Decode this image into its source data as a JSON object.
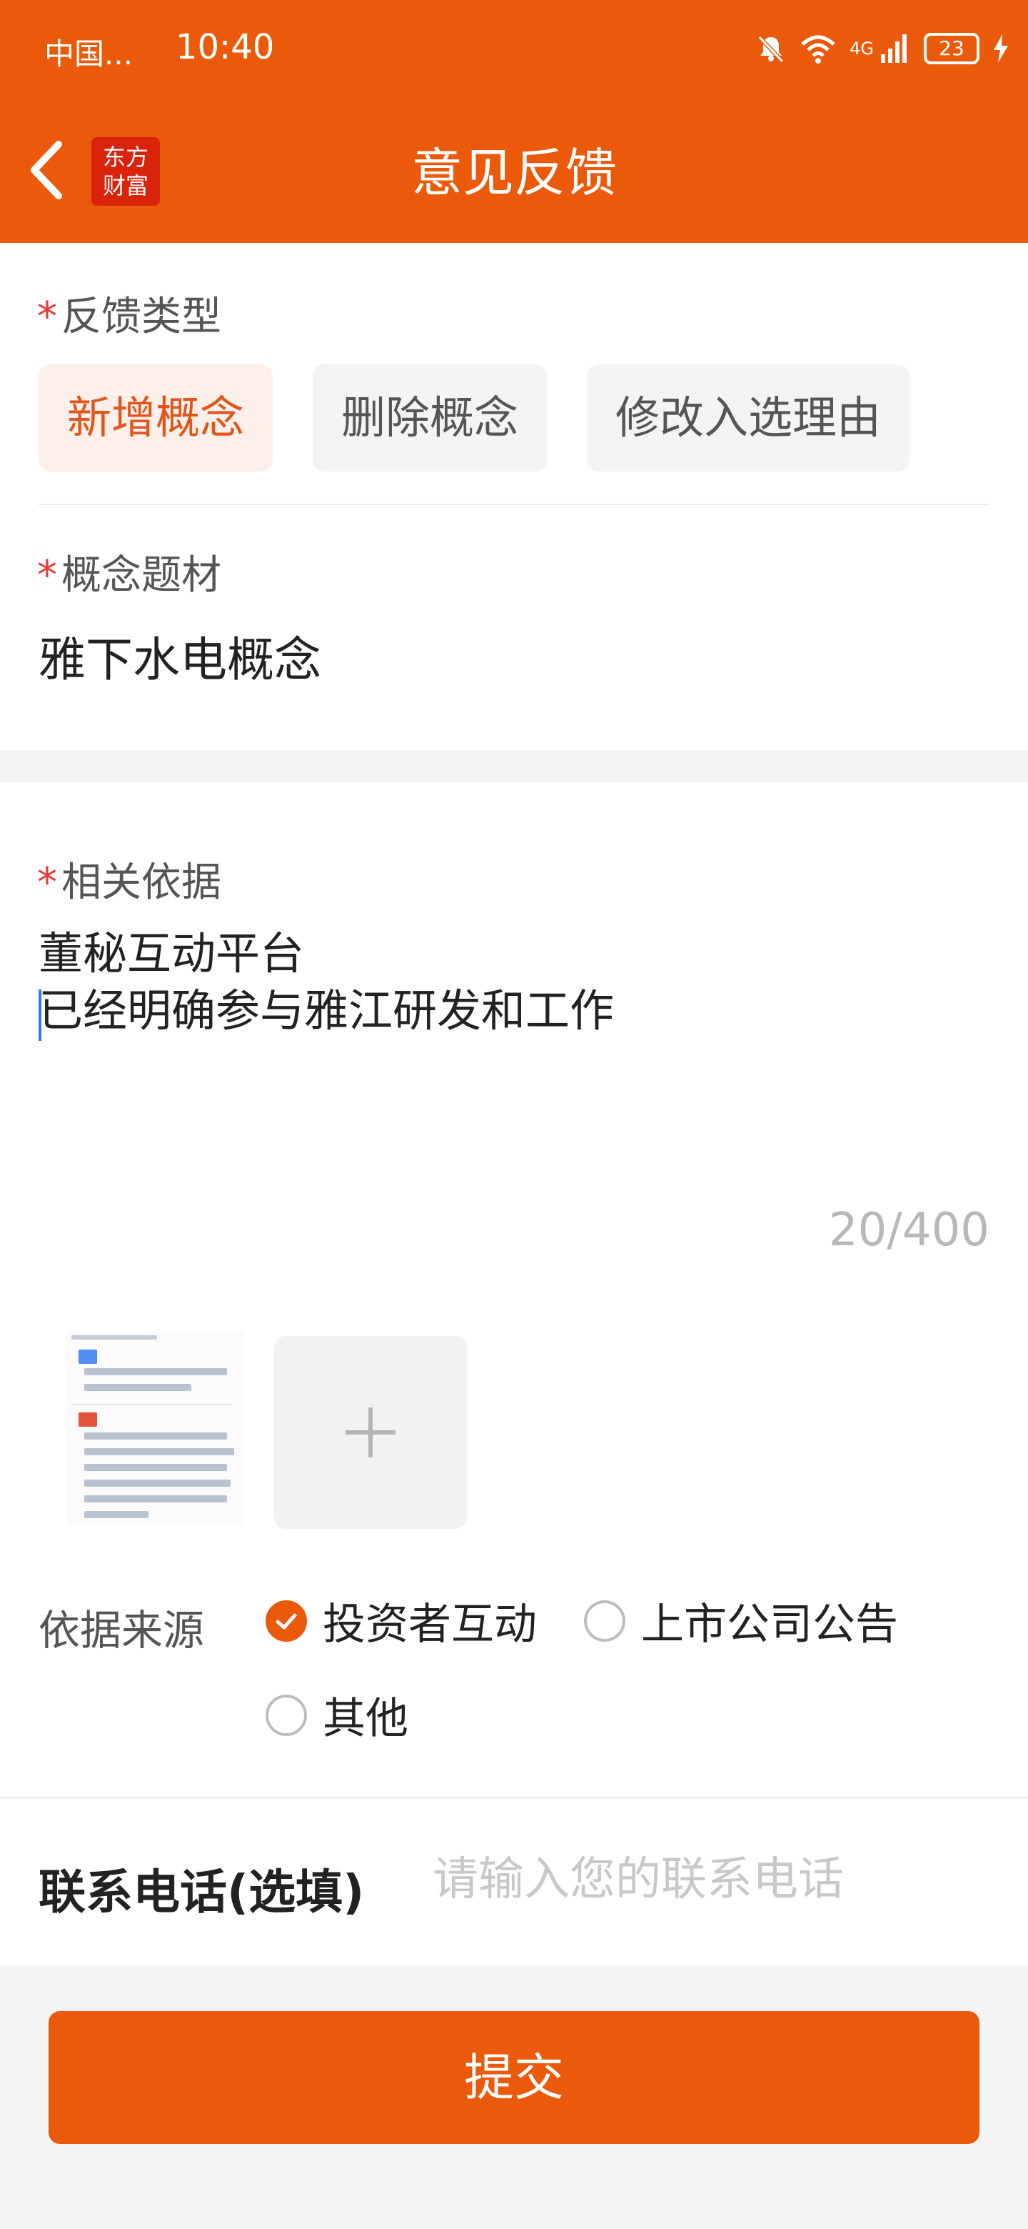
{
  "status_bar": {
    "carrier": "中国...",
    "time": "10:40",
    "network": "4G",
    "battery": "23"
  },
  "header": {
    "title": "意见反馈",
    "logo_line1": "东方",
    "logo_line2": "财富"
  },
  "feedback_type": {
    "label": "反馈类型",
    "required_mark": "*",
    "options": [
      "新增概念",
      "删除概念",
      "修改入选理由"
    ],
    "selected": "新增概念"
  },
  "concept": {
    "label": "概念题材",
    "required_mark": "*",
    "value": "雅下水电概念"
  },
  "basis": {
    "label": "相关依据",
    "required_mark": "*",
    "line1": "董秘互动平台",
    "line2": "已经明确参与雅江研发和工作",
    "counter": "20/400"
  },
  "source": {
    "label": "依据来源",
    "options": [
      "投资者互动",
      "上市公司公告",
      "其他"
    ],
    "selected": "投资者互动"
  },
  "phone": {
    "label": "联系电话(选填)",
    "placeholder": "请输入您的联系电话",
    "value": ""
  },
  "submit_label": "提交",
  "colors": {
    "brand": "#eb5a0a",
    "required": "#e53935",
    "chip_active_bg": "#fdf0ea"
  }
}
